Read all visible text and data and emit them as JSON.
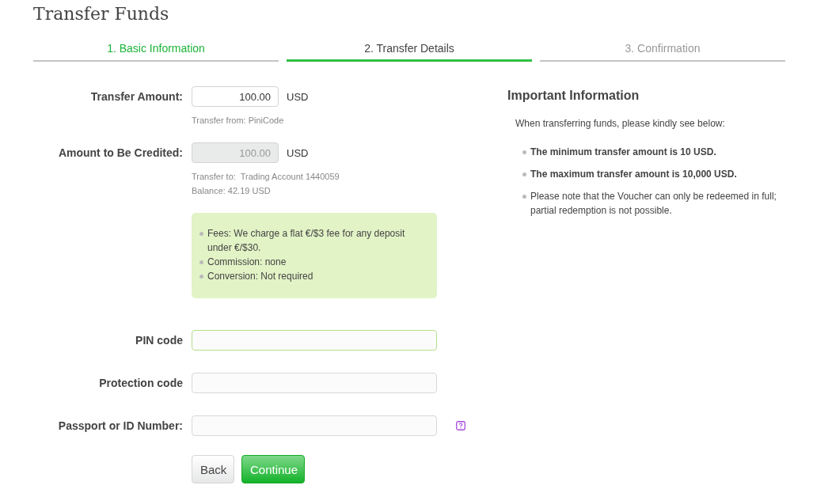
{
  "page_title": "Transfer Funds",
  "steps": [
    {
      "label": "1. Basic Information",
      "completed": true,
      "selected": false
    },
    {
      "label": "2. Transfer Details",
      "completed": false,
      "selected": true
    },
    {
      "label": "3. Confirmation",
      "completed": false,
      "selected": false
    }
  ],
  "amount_fields": [
    {
      "label": "Transfer Amount:",
      "value": "100.00",
      "unit": "USD",
      "disabled": false,
      "hints": [
        "Transfer from: PiniCode"
      ]
    },
    {
      "label": "Amount to Be Credited:",
      "value": "100.00",
      "unit": "USD",
      "disabled": true,
      "hints": [
        "Transfer to:  Trading Account 1440059",
        "Balance: 42.19 USD"
      ]
    }
  ],
  "fees_notes": [
    "Fees: We charge a flat €/$3 fee for any deposit under €/$30.",
    "Commission: none",
    "Conversion: Not required"
  ],
  "code_fields": [
    {
      "label": "PIN code",
      "focused": true,
      "help": false
    },
    {
      "label": "Protection code",
      "focused": false,
      "help": false
    },
    {
      "label": "Passport or ID Number:",
      "focused": false,
      "help": true
    }
  ],
  "buttons": [
    {
      "label": "Back",
      "kind": "secondary"
    },
    {
      "label": "Continue",
      "kind": "primary"
    }
  ],
  "info": {
    "title": "Important Information",
    "intro": "When transferring funds, please kindly see below:",
    "items": [
      {
        "text": "The minimum transfer amount is 10 USD.",
        "bold": true
      },
      {
        "text": "The maximum transfer amount is 10,000 USD.",
        "bold": true
      },
      {
        "text": "Please note that the Voucher can only be redeemed in full; partial redemption is not possible.",
        "bold": false
      }
    ]
  }
}
